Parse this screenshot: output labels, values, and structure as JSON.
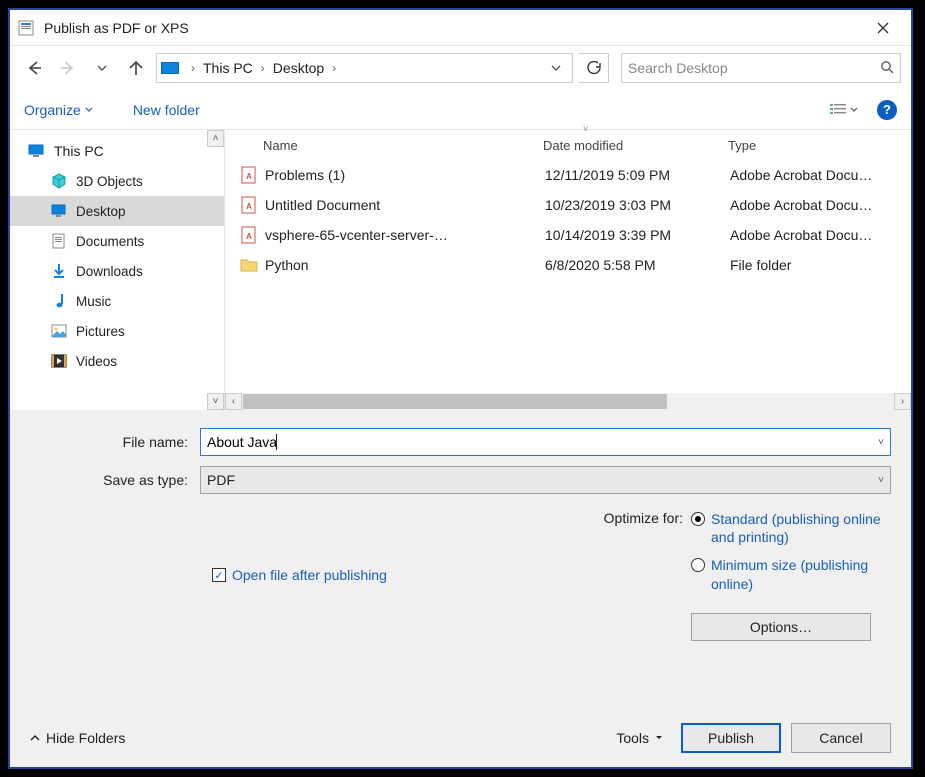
{
  "window": {
    "title": "Publish as PDF or XPS"
  },
  "breadcrumb": {
    "root": "This PC",
    "folder": "Desktop"
  },
  "search": {
    "placeholder": "Search Desktop"
  },
  "toolbar": {
    "organize": "Organize",
    "new_folder": "New folder"
  },
  "tree": {
    "root": "This PC",
    "items": [
      {
        "label": "3D Objects",
        "icon": "cube"
      },
      {
        "label": "Desktop",
        "icon": "desktop",
        "selected": true
      },
      {
        "label": "Documents",
        "icon": "doc"
      },
      {
        "label": "Downloads",
        "icon": "download"
      },
      {
        "label": "Music",
        "icon": "music"
      },
      {
        "label": "Pictures",
        "icon": "pictures"
      },
      {
        "label": "Videos",
        "icon": "videos"
      }
    ]
  },
  "columns": {
    "name": "Name",
    "date": "Date modified",
    "type": "Type"
  },
  "files": [
    {
      "name": "Problems (1)",
      "date": "12/11/2019 5:09 PM",
      "type": "Adobe Acrobat Docu…",
      "kind": "pdf"
    },
    {
      "name": "Untitled Document",
      "date": "10/23/2019 3:03 PM",
      "type": "Adobe Acrobat Docu…",
      "kind": "pdf"
    },
    {
      "name": "vsphere-65-vcenter-server-…",
      "date": "10/14/2019 3:39 PM",
      "type": "Adobe Acrobat Docu…",
      "kind": "pdf"
    },
    {
      "name": "Python",
      "date": "6/8/2020 5:58 PM",
      "type": "File folder",
      "kind": "folder"
    }
  ],
  "form": {
    "filename_label": "File name:",
    "filename_value": "About Java",
    "savetype_label": "Save as type:",
    "savetype_value": "PDF",
    "open_after_publish": "Open file after publishing",
    "optimize_label": "Optimize for:",
    "opt_standard": "Standard (publishing online and printing)",
    "opt_minimum": "Minimum size (publishing online)",
    "options_button": "Options…"
  },
  "footer": {
    "hide_folders": "Hide Folders",
    "tools": "Tools",
    "publish": "Publish",
    "cancel": "Cancel"
  }
}
